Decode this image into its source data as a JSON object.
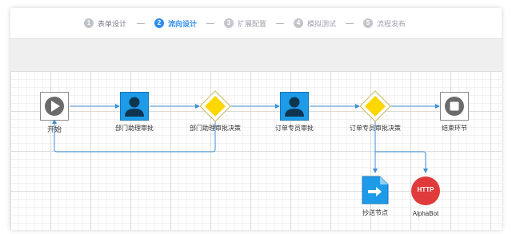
{
  "steps": [
    {
      "num": "1",
      "label": "表单设计",
      "state": "done"
    },
    {
      "num": "2",
      "label": "流向设计",
      "state": "active"
    },
    {
      "num": "3",
      "label": "扩展配置",
      "state": "todo"
    },
    {
      "num": "4",
      "label": "模拟测试",
      "state": "todo"
    },
    {
      "num": "5",
      "label": "流程发布",
      "state": "todo"
    }
  ],
  "step_separator": "—",
  "nodes": {
    "start": "开始",
    "dept_approval": "部门助理审批",
    "dept_decision": "部门助理审批决策",
    "order_approval": "订单专员审批",
    "order_decision": "订单专员审批决策",
    "end": "结束环节",
    "cc": "抄送节点",
    "http": "AlphaBot",
    "http_badge": "HTTP"
  },
  "colors": {
    "active": "#2d8cf0",
    "user_node": "#1e9be8",
    "decision": "#ffd700",
    "http": "#e03a3a",
    "gray_node": "#6b6b6b",
    "link": "#3f8fd6"
  },
  "icons": {
    "start": "play-icon",
    "user": "user-icon",
    "decision": "diamond-icon",
    "end": "stop-icon",
    "cc": "send-file-icon",
    "http": "http-icon"
  }
}
